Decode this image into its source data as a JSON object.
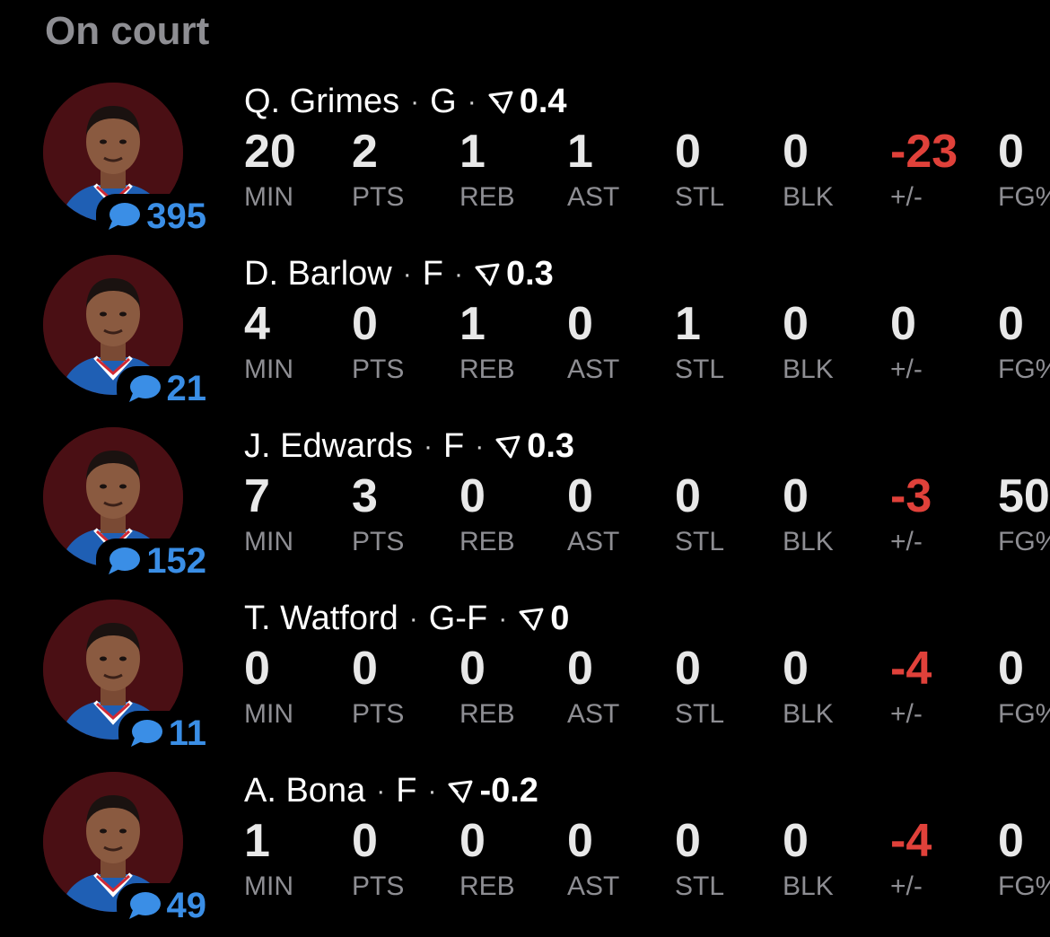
{
  "section_title": "On court",
  "players": [
    {
      "name": "Q. Grimes",
      "position": "G",
      "rating": "0.4",
      "comments": "395",
      "stats": [
        {
          "label": "MIN",
          "value": "20",
          "negative": false
        },
        {
          "label": "PTS",
          "value": "2",
          "negative": false
        },
        {
          "label": "REB",
          "value": "1",
          "negative": false
        },
        {
          "label": "AST",
          "value": "1",
          "negative": false
        },
        {
          "label": "STL",
          "value": "0",
          "negative": false
        },
        {
          "label": "BLK",
          "value": "0",
          "negative": false
        },
        {
          "label": "+/-",
          "value": "-23",
          "negative": true
        },
        {
          "label": "FG%",
          "value": "0",
          "negative": false
        }
      ]
    },
    {
      "name": "D. Barlow",
      "position": "F",
      "rating": "0.3",
      "comments": "21",
      "stats": [
        {
          "label": "MIN",
          "value": "4",
          "negative": false
        },
        {
          "label": "PTS",
          "value": "0",
          "negative": false
        },
        {
          "label": "REB",
          "value": "1",
          "negative": false
        },
        {
          "label": "AST",
          "value": "0",
          "negative": false
        },
        {
          "label": "STL",
          "value": "1",
          "negative": false
        },
        {
          "label": "BLK",
          "value": "0",
          "negative": false
        },
        {
          "label": "+/-",
          "value": "0",
          "negative": false
        },
        {
          "label": "FG%",
          "value": "0",
          "negative": false
        }
      ]
    },
    {
      "name": "J. Edwards",
      "position": "F",
      "rating": "0.3",
      "comments": "152",
      "stats": [
        {
          "label": "MIN",
          "value": "7",
          "negative": false
        },
        {
          "label": "PTS",
          "value": "3",
          "negative": false
        },
        {
          "label": "REB",
          "value": "0",
          "negative": false
        },
        {
          "label": "AST",
          "value": "0",
          "negative": false
        },
        {
          "label": "STL",
          "value": "0",
          "negative": false
        },
        {
          "label": "BLK",
          "value": "0",
          "negative": false
        },
        {
          "label": "+/-",
          "value": "-3",
          "negative": true
        },
        {
          "label": "FG%",
          "value": "50",
          "negative": false
        }
      ]
    },
    {
      "name": "T. Watford",
      "position": "G-F",
      "rating": "0",
      "comments": "11",
      "stats": [
        {
          "label": "MIN",
          "value": "0",
          "negative": false
        },
        {
          "label": "PTS",
          "value": "0",
          "negative": false
        },
        {
          "label": "REB",
          "value": "0",
          "negative": false
        },
        {
          "label": "AST",
          "value": "0",
          "negative": false
        },
        {
          "label": "STL",
          "value": "0",
          "negative": false
        },
        {
          "label": "BLK",
          "value": "0",
          "negative": false
        },
        {
          "label": "+/-",
          "value": "-4",
          "negative": true
        },
        {
          "label": "FG%",
          "value": "0",
          "negative": false
        }
      ]
    },
    {
      "name": "A. Bona",
      "position": "F",
      "rating": "-0.2",
      "comments": "49",
      "stats": [
        {
          "label": "MIN",
          "value": "1",
          "negative": false
        },
        {
          "label": "PTS",
          "value": "0",
          "negative": false
        },
        {
          "label": "REB",
          "value": "0",
          "negative": false
        },
        {
          "label": "AST",
          "value": "0",
          "negative": false
        },
        {
          "label": "STL",
          "value": "0",
          "negative": false
        },
        {
          "label": "BLK",
          "value": "0",
          "negative": false
        },
        {
          "label": "+/-",
          "value": "-4",
          "negative": true
        },
        {
          "label": "FG%",
          "value": "0",
          "negative": false
        }
      ]
    }
  ],
  "colors": {
    "background": "#000000",
    "title": "#8e8e93",
    "stat_value": "#e8e8e8",
    "negative": "#e0413a",
    "label": "#8e8e93",
    "comment_accent": "#3a8ee6",
    "avatar_bg": "#4a0f14"
  },
  "icons": {
    "comment": "speech-bubble-icon",
    "rating": "rating-triangle-icon"
  }
}
